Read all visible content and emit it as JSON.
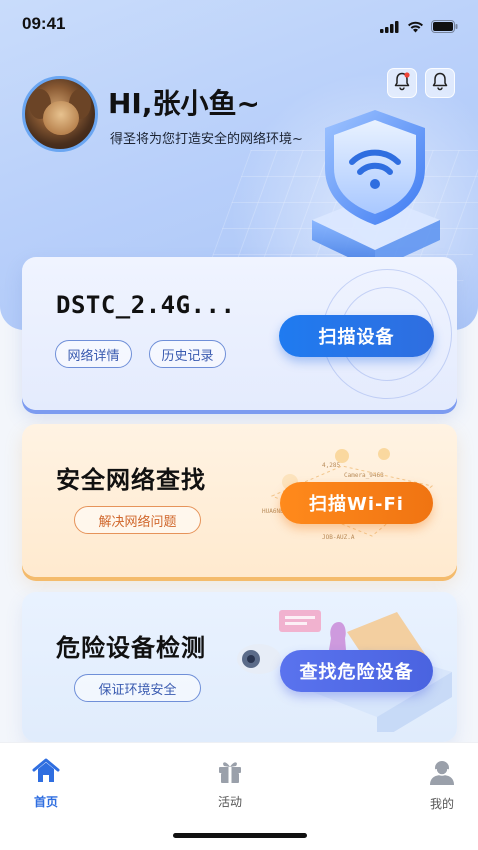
{
  "status_bar": {
    "time": "09:41"
  },
  "header": {
    "greeting": "HI,张小鱼~",
    "subtitle": "得圣将为您打造安全的网络环境~"
  },
  "cards": {
    "network": {
      "title": "DSTC_2.4G...",
      "pill_details": "网络详情",
      "pill_history": "历史记录",
      "button": "扫描设备"
    },
    "wifi": {
      "title": "安全网络查找",
      "pill": "解决网络问题",
      "button": "扫描Wi-Fi",
      "deco": [
        "4,285",
        "Camera_9468",
        "HUA6NE",
        "JOB-AUZ.A"
      ]
    },
    "danger": {
      "title": "危险设备检测",
      "pill": "保证环境安全",
      "button": "查找危险设备"
    }
  },
  "tabbar": {
    "home": "首页",
    "activity": "活动",
    "mine": "我的"
  },
  "colors": {
    "primary_blue": "#2f6ee0",
    "orange": "#f07412",
    "purple": "#4a63e0"
  }
}
